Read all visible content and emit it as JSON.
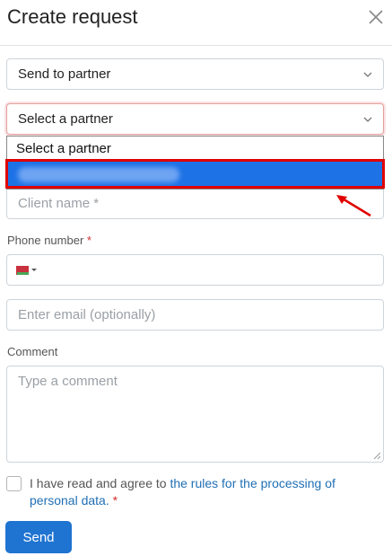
{
  "dialog": {
    "title": "Create request"
  },
  "request_type": {
    "selected": "Send to partner"
  },
  "partner_select": {
    "selected": "Select a partner",
    "options": [
      "Select a partner"
    ]
  },
  "client_name": {
    "placeholder": "Client name *"
  },
  "phone": {
    "label": "Phone number",
    "required_mark": "*"
  },
  "email": {
    "placeholder": "Enter email (optionally)"
  },
  "comment": {
    "label": "Comment",
    "placeholder": "Type a comment"
  },
  "consent": {
    "text_before": "I have read and agree to ",
    "link_text": "the rules for the processing of personal data.",
    "required_mark": "*"
  },
  "actions": {
    "send_label": "Send"
  },
  "colors": {
    "primary": "#1f74d1",
    "highlight": "#1d72e6",
    "annotation": "#e00000"
  }
}
